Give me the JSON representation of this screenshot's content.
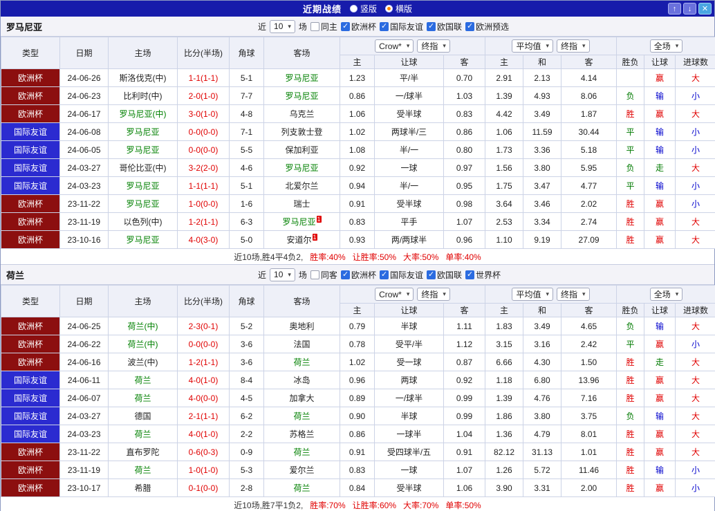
{
  "titlebar": {
    "title": "近期战绩",
    "layout_options": [
      {
        "label": "竖版",
        "selected": false
      },
      {
        "label": "横版",
        "selected": true
      }
    ],
    "buttons": {
      "up": "↑",
      "down": "↓",
      "close": "✕"
    }
  },
  "labels": {
    "near": "近",
    "count": "10",
    "matches": "场",
    "crow": "Crow*",
    "final": "终指",
    "avg": "平均值",
    "full": "全场"
  },
  "table_head": {
    "type": "类型",
    "date": "日期",
    "home": "主场",
    "score": "比分(半场)",
    "corner": "角球",
    "away": "客场",
    "sub": [
      "主",
      "让球",
      "客",
      "主",
      "和",
      "客",
      "胜负",
      "让球",
      "进球数"
    ]
  },
  "colors": {
    "focus_team": "#008000",
    "win": "#e00000",
    "draw_walk": "#007a00",
    "loss": "#0000cc",
    "type_cup_bg": "#8c0f0f",
    "type_friendly_bg": "#2b2bd0",
    "titlebar_bg": "#171cab"
  },
  "sections": [
    {
      "team": "罗马尼亚",
      "same_label": "同主",
      "same_checked": false,
      "leagues": [
        {
          "label": "欧洲杯",
          "checked": true
        },
        {
          "label": "国际友谊",
          "checked": true
        },
        {
          "label": "欧国联",
          "checked": true
        },
        {
          "label": "欧洲预选",
          "checked": true
        }
      ],
      "rows": [
        {
          "type": "欧洲杯",
          "tc": "cup",
          "date": "24-06-26",
          "home": "斯洛伐克(中)",
          "hf": false,
          "score": "1-1(1-1)",
          "corner": "5-1",
          "away": "罗马尼亚",
          "af": true,
          "odds": [
            "1.23",
            "平/半",
            "0.70",
            "2.91",
            "2.13",
            "4.14"
          ],
          "res": [
            [
              "",
              ""
            ],
            [
              "赢",
              "red"
            ],
            [
              "大",
              "red"
            ]
          ]
        },
        {
          "type": "欧洲杯",
          "tc": "cup",
          "date": "24-06-23",
          "home": "比利时(中)",
          "hf": false,
          "score": "2-0(1-0)",
          "corner": "7-7",
          "away": "罗马尼亚",
          "af": true,
          "odds": [
            "0.86",
            "一/球半",
            "1.03",
            "1.39",
            "4.93",
            "8.06"
          ],
          "res": [
            [
              "负",
              "green"
            ],
            [
              "输",
              "blue"
            ],
            [
              "小",
              "blue"
            ]
          ]
        },
        {
          "type": "欧洲杯",
          "tc": "cup",
          "date": "24-06-17",
          "home": "罗马尼亚(中)",
          "hf": true,
          "score": "3-0(1-0)",
          "corner": "4-8",
          "away": "乌克兰",
          "af": false,
          "odds": [
            "1.06",
            "受半球",
            "0.83",
            "4.42",
            "3.49",
            "1.87"
          ],
          "res": [
            [
              "胜",
              "red"
            ],
            [
              "赢",
              "red"
            ],
            [
              "大",
              "red"
            ]
          ]
        },
        {
          "type": "国际友谊",
          "tc": "friendly",
          "date": "24-06-08",
          "home": "罗马尼亚",
          "hf": true,
          "score": "0-0(0-0)",
          "corner": "7-1",
          "away": "列支敦士登",
          "af": false,
          "odds": [
            "1.02",
            "两球半/三",
            "0.86",
            "1.06",
            "11.59",
            "30.44"
          ],
          "res": [
            [
              "平",
              "green"
            ],
            [
              "输",
              "blue"
            ],
            [
              "小",
              "blue"
            ]
          ]
        },
        {
          "type": "国际友谊",
          "tc": "friendly",
          "date": "24-06-05",
          "home": "罗马尼亚",
          "hf": true,
          "score": "0-0(0-0)",
          "corner": "5-5",
          "away": "保加利亚",
          "af": false,
          "odds": [
            "1.08",
            "半/一",
            "0.80",
            "1.73",
            "3.36",
            "5.18"
          ],
          "res": [
            [
              "平",
              "green"
            ],
            [
              "输",
              "blue"
            ],
            [
              "小",
              "blue"
            ]
          ]
        },
        {
          "type": "国际友谊",
          "tc": "friendly",
          "date": "24-03-27",
          "home": "哥伦比亚(中)",
          "hf": false,
          "score": "3-2(2-0)",
          "corner": "4-6",
          "away": "罗马尼亚",
          "af": true,
          "odds": [
            "0.92",
            "一球",
            "0.97",
            "1.56",
            "3.80",
            "5.95"
          ],
          "res": [
            [
              "负",
              "green"
            ],
            [
              "走",
              "green"
            ],
            [
              "大",
              "red"
            ]
          ]
        },
        {
          "type": "国际友谊",
          "tc": "friendly",
          "date": "24-03-23",
          "home": "罗马尼亚",
          "hf": true,
          "score": "1-1(1-1)",
          "corner": "5-1",
          "away": "北爱尔兰",
          "af": false,
          "odds": [
            "0.94",
            "半/一",
            "0.95",
            "1.75",
            "3.47",
            "4.77"
          ],
          "res": [
            [
              "平",
              "green"
            ],
            [
              "输",
              "blue"
            ],
            [
              "小",
              "blue"
            ]
          ]
        },
        {
          "type": "欧洲杯",
          "tc": "cup",
          "date": "23-11-22",
          "home": "罗马尼亚",
          "hf": true,
          "score": "1-0(0-0)",
          "corner": "1-6",
          "away": "瑞士",
          "af": false,
          "odds": [
            "0.91",
            "受半球",
            "0.98",
            "3.64",
            "3.46",
            "2.02"
          ],
          "res": [
            [
              "胜",
              "red"
            ],
            [
              "赢",
              "red"
            ],
            [
              "小",
              "blue"
            ]
          ]
        },
        {
          "type": "欧洲杯",
          "tc": "cup",
          "date": "23-11-19",
          "home": "以色列(中)",
          "hf": false,
          "score": "1-2(1-1)",
          "corner": "6-3",
          "away": "罗马尼亚",
          "af": true,
          "ab": "1",
          "odds": [
            "0.83",
            "平手",
            "1.07",
            "2.53",
            "3.34",
            "2.74"
          ],
          "res": [
            [
              "胜",
              "red"
            ],
            [
              "赢",
              "red"
            ],
            [
              "大",
              "red"
            ]
          ]
        },
        {
          "type": "欧洲杯",
          "tc": "cup",
          "date": "23-10-16",
          "home": "罗马尼亚",
          "hf": true,
          "score": "4-0(3-0)",
          "corner": "5-0",
          "away": "安道尔",
          "af": false,
          "ab": "1",
          "odds": [
            "0.93",
            "两/两球半",
            "0.96",
            "1.10",
            "9.19",
            "27.09"
          ],
          "res": [
            [
              "胜",
              "red"
            ],
            [
              "赢",
              "red"
            ],
            [
              "大",
              "red"
            ]
          ]
        }
      ],
      "footer": {
        "lead": "近10场,胜4平4负2,",
        "stats": [
          "胜率:40%",
          "让胜率:50%",
          "大率:50%",
          "单率:40%"
        ]
      }
    },
    {
      "team": "荷兰",
      "same_label": "同客",
      "same_checked": false,
      "leagues": [
        {
          "label": "欧洲杯",
          "checked": true
        },
        {
          "label": "国际友谊",
          "checked": true
        },
        {
          "label": "欧国联",
          "checked": true
        },
        {
          "label": "世界杯",
          "checked": true
        }
      ],
      "rows": [
        {
          "type": "欧洲杯",
          "tc": "cup",
          "date": "24-06-25",
          "home": "荷兰(中)",
          "hf": true,
          "score": "2-3(0-1)",
          "corner": "5-2",
          "away": "奥地利",
          "af": false,
          "odds": [
            "0.79",
            "半球",
            "1.11",
            "1.83",
            "3.49",
            "4.65"
          ],
          "res": [
            [
              "负",
              "green"
            ],
            [
              "输",
              "blue"
            ],
            [
              "大",
              "red"
            ]
          ]
        },
        {
          "type": "欧洲杯",
          "tc": "cup",
          "date": "24-06-22",
          "home": "荷兰(中)",
          "hf": true,
          "score": "0-0(0-0)",
          "corner": "3-6",
          "away": "法国",
          "af": false,
          "odds": [
            "0.78",
            "受平/半",
            "1.12",
            "3.15",
            "3.16",
            "2.42"
          ],
          "res": [
            [
              "平",
              "green"
            ],
            [
              "赢",
              "red"
            ],
            [
              "小",
              "blue"
            ]
          ]
        },
        {
          "type": "欧洲杯",
          "tc": "cup",
          "date": "24-06-16",
          "home": "波兰(中)",
          "hf": false,
          "score": "1-2(1-1)",
          "corner": "3-6",
          "away": "荷兰",
          "af": true,
          "odds": [
            "1.02",
            "受一球",
            "0.87",
            "6.66",
            "4.30",
            "1.50"
          ],
          "res": [
            [
              "胜",
              "red"
            ],
            [
              "走",
              "green"
            ],
            [
              "大",
              "red"
            ]
          ]
        },
        {
          "type": "国际友谊",
          "tc": "friendly",
          "date": "24-06-11",
          "home": "荷兰",
          "hf": true,
          "score": "4-0(1-0)",
          "corner": "8-4",
          "away": "冰岛",
          "af": false,
          "odds": [
            "0.96",
            "两球",
            "0.92",
            "1.18",
            "6.80",
            "13.96"
          ],
          "res": [
            [
              "胜",
              "red"
            ],
            [
              "赢",
              "red"
            ],
            [
              "大",
              "red"
            ]
          ]
        },
        {
          "type": "国际友谊",
          "tc": "friendly",
          "date": "24-06-07",
          "home": "荷兰",
          "hf": true,
          "score": "4-0(0-0)",
          "corner": "4-5",
          "away": "加拿大",
          "af": false,
          "odds": [
            "0.89",
            "一/球半",
            "0.99",
            "1.39",
            "4.76",
            "7.16"
          ],
          "res": [
            [
              "胜",
              "red"
            ],
            [
              "赢",
              "red"
            ],
            [
              "大",
              "red"
            ]
          ]
        },
        {
          "type": "国际友谊",
          "tc": "friendly",
          "date": "24-03-27",
          "home": "德国",
          "hf": false,
          "score": "2-1(1-1)",
          "corner": "6-2",
          "away": "荷兰",
          "af": true,
          "odds": [
            "0.90",
            "半球",
            "0.99",
            "1.86",
            "3.80",
            "3.75"
          ],
          "res": [
            [
              "负",
              "green"
            ],
            [
              "输",
              "blue"
            ],
            [
              "大",
              "red"
            ]
          ]
        },
        {
          "type": "国际友谊",
          "tc": "friendly",
          "date": "24-03-23",
          "home": "荷兰",
          "hf": true,
          "score": "4-0(1-0)",
          "corner": "2-2",
          "away": "苏格兰",
          "af": false,
          "odds": [
            "0.86",
            "一球半",
            "1.04",
            "1.36",
            "4.79",
            "8.01"
          ],
          "res": [
            [
              "胜",
              "red"
            ],
            [
              "赢",
              "red"
            ],
            [
              "大",
              "red"
            ]
          ]
        },
        {
          "type": "欧洲杯",
          "tc": "cup",
          "date": "23-11-22",
          "home": "直布罗陀",
          "hf": false,
          "score": "0-6(0-3)",
          "corner": "0-9",
          "away": "荷兰",
          "af": true,
          "odds": [
            "0.91",
            "受四球半/五",
            "0.91",
            "82.12",
            "31.13",
            "1.01"
          ],
          "res": [
            [
              "胜",
              "red"
            ],
            [
              "赢",
              "red"
            ],
            [
              "大",
              "red"
            ]
          ]
        },
        {
          "type": "欧洲杯",
          "tc": "cup",
          "date": "23-11-19",
          "home": "荷兰",
          "hf": true,
          "score": "1-0(1-0)",
          "corner": "5-3",
          "away": "爱尔兰",
          "af": false,
          "odds": [
            "0.83",
            "一球",
            "1.07",
            "1.26",
            "5.72",
            "11.46"
          ],
          "res": [
            [
              "胜",
              "red"
            ],
            [
              "输",
              "blue"
            ],
            [
              "小",
              "blue"
            ]
          ]
        },
        {
          "type": "欧洲杯",
          "tc": "cup",
          "date": "23-10-17",
          "home": "希腊",
          "hf": false,
          "score": "0-1(0-0)",
          "corner": "2-8",
          "away": "荷兰",
          "af": true,
          "odds": [
            "0.84",
            "受半球",
            "1.06",
            "3.90",
            "3.31",
            "2.00"
          ],
          "res": [
            [
              "胜",
              "red"
            ],
            [
              "赢",
              "red"
            ],
            [
              "小",
              "blue"
            ]
          ]
        }
      ],
      "footer": {
        "lead": "近10场,胜7平1负2,",
        "stats": [
          "胜率:70%",
          "让胜率:60%",
          "大率:70%",
          "单率:50%"
        ]
      }
    }
  ]
}
